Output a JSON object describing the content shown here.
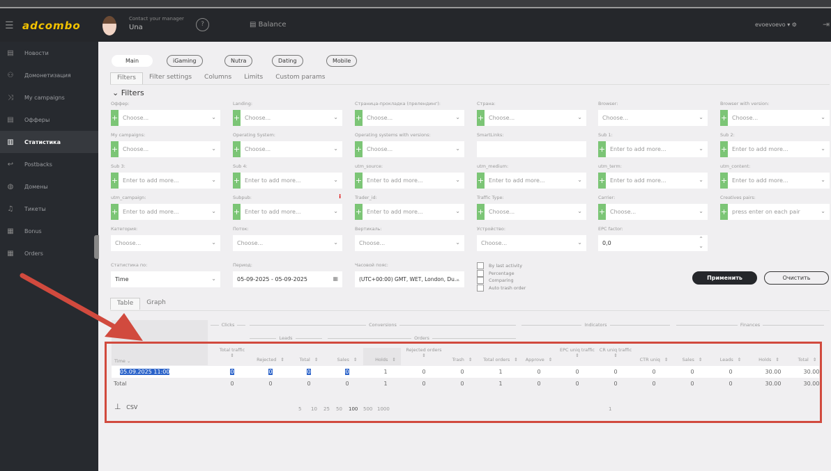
{
  "header": {
    "logo": "adcombo",
    "manager_label": "Contact your manager",
    "manager_name": "Una",
    "help": "?",
    "balance": "Balance",
    "user": "evoevoevo ▾ ⚙"
  },
  "sidebar": {
    "items": [
      {
        "label": "Новости",
        "icon": "news-icon",
        "glyph": "▤"
      },
      {
        "label": "Домонетизация",
        "icon": "monetization-icon",
        "glyph": "⚇"
      },
      {
        "label": "My campaigns",
        "icon": "shuffle-icon",
        "glyph": "⤨"
      },
      {
        "label": "Офферы",
        "icon": "offers-icon",
        "glyph": "▤"
      },
      {
        "label": "Статистика",
        "icon": "bar-chart-icon",
        "glyph": "▥",
        "active": true
      },
      {
        "label": "Postbacks",
        "icon": "return-arrow-icon",
        "glyph": "↩"
      },
      {
        "label": "Домены",
        "icon": "globe-icon",
        "glyph": "◍"
      },
      {
        "label": "Тикеты",
        "icon": "bell-icon",
        "glyph": "♫"
      },
      {
        "label": "Bonus",
        "icon": "gift-icon",
        "glyph": "▦"
      },
      {
        "label": "Orders",
        "icon": "calendar-icon",
        "glyph": "▦"
      }
    ]
  },
  "verticals": [
    {
      "label": "Main"
    },
    {
      "label": "iGaming"
    },
    {
      "label": "Nutra"
    },
    {
      "label": "Dating"
    },
    {
      "label": "Mobile"
    }
  ],
  "tabs": [
    "Filters",
    "Filter settings",
    "Columns",
    "Limits",
    "Custom params"
  ],
  "filters_title": "Filters",
  "filters": [
    [
      {
        "label": "Оффер:",
        "ph": "Choose...",
        "plus": true
      },
      {
        "label": "Landing:",
        "ph": "Choose...",
        "plus": true
      },
      {
        "label": "Страница-прокладка (прелендинг):",
        "ph": "Choose...",
        "plus": true
      },
      {
        "label": "Страна:",
        "ph": "Choose...",
        "plus": true
      },
      {
        "label": "Browser:",
        "ph": "Choose...",
        "plus": false
      },
      {
        "label": "Browser with version:",
        "ph": "Choose...",
        "plus": true
      }
    ],
    [
      {
        "label": "My campaigns:",
        "ph": "Choose...",
        "plus": true
      },
      {
        "label": "Operating System:",
        "ph": "Choose...",
        "plus": true
      },
      {
        "label": "Operating systems with versions:",
        "ph": "Choose...",
        "plus": true
      },
      {
        "label": "SmartLinks:",
        "ph": "",
        "plus": false,
        "nochev": true
      },
      {
        "label": "Sub 1:",
        "ph": "Enter to add more...",
        "plus": true
      },
      {
        "label": "Sub 2:",
        "ph": "Enter to add more...",
        "plus": true
      }
    ],
    [
      {
        "label": "Sub 3:",
        "ph": "Enter to add more...",
        "plus": true
      },
      {
        "label": "Sub 4:",
        "ph": "Enter to add more...",
        "plus": true
      },
      {
        "label": "utm_source:",
        "ph": "Enter to add more...",
        "plus": true
      },
      {
        "label": "utm_medium:",
        "ph": "Enter to add more...",
        "plus": true
      },
      {
        "label": "utm_term:",
        "ph": "Enter to add more...",
        "plus": true
      },
      {
        "label": "utm_content:",
        "ph": "Enter to add more...",
        "plus": true
      }
    ],
    [
      {
        "label": "utm_campaign:",
        "ph": "Enter to add more...",
        "plus": true
      },
      {
        "label": "Subpub:",
        "ph": "Enter to add more...",
        "plus": true,
        "info": "i"
      },
      {
        "label": "Trader_id:",
        "ph": "Enter to add more...",
        "plus": true
      },
      {
        "label": "Traffic Type:",
        "ph": "Choose...",
        "plus": true
      },
      {
        "label": "Carrier:",
        "ph": "Choose...",
        "plus": true
      },
      {
        "label": "Creatives pairs:",
        "ph": "press enter on each pair",
        "plus": true
      }
    ],
    [
      {
        "label": "Категория:",
        "ph": "Choose...",
        "plus": false
      },
      {
        "label": "Поток:",
        "ph": "Choose...",
        "plus": false
      },
      {
        "label": "Вертикаль:",
        "ph": "Choose...",
        "plus": false
      },
      {
        "label": "Устройство:",
        "ph": "Choose...",
        "plus": false
      },
      {
        "label": "EPC factor:",
        "ph": "0,0",
        "plus": false,
        "stepper": true
      }
    ]
  ],
  "stats_by": {
    "label": "Статистика по:",
    "value": "Time"
  },
  "period": {
    "label": "Период:",
    "value": "05-09-2025 - 05-09-2025"
  },
  "timezone": {
    "label": "Часовой пояс:",
    "value": "(UTC+00:00) GMT, WET, London, Du..."
  },
  "checkboxes": [
    "By last activity",
    "Percentage",
    "Comparing",
    "Auto trash order"
  ],
  "apply": "Применить",
  "clear": "Очистить",
  "table_tabs": [
    "Table",
    "Graph"
  ],
  "groups": {
    "clicks": "Clicks",
    "conversions": "Conversions",
    "leads": "Leads",
    "orders": "Orders",
    "indicators": "Indicators",
    "finances": "Finances"
  },
  "columns": [
    "Total traffic",
    "Rejected",
    "Total",
    "Sales",
    "Holds",
    "Rejected orders",
    "Trash",
    "Total orders",
    "Approve",
    "EPC uniq traffic",
    "CR uniq traffic",
    "CTR uniq",
    "Sales",
    "Leads",
    "Holds",
    "Total"
  ],
  "time_col": "Time",
  "rows": [
    {
      "time": "05.09.2025 11:00",
      "values": [
        "0",
        "0",
        "0",
        "0",
        "1",
        "0",
        "0",
        "1",
        "0",
        "0",
        "0",
        "0",
        "0",
        "0",
        "30.00",
        "30.00"
      ]
    },
    {
      "time": "Total",
      "values": [
        "0",
        "0",
        "0",
        "0",
        "1",
        "0",
        "0",
        "1",
        "0",
        "0",
        "0",
        "0",
        "0",
        "0",
        "30.00",
        "30.00"
      ]
    }
  ],
  "csv": "CSV",
  "page_sizes": [
    "5",
    "10",
    "25",
    "50",
    "100",
    "500",
    "1000"
  ],
  "page": "1",
  "annotation_color": "#d14a3e"
}
